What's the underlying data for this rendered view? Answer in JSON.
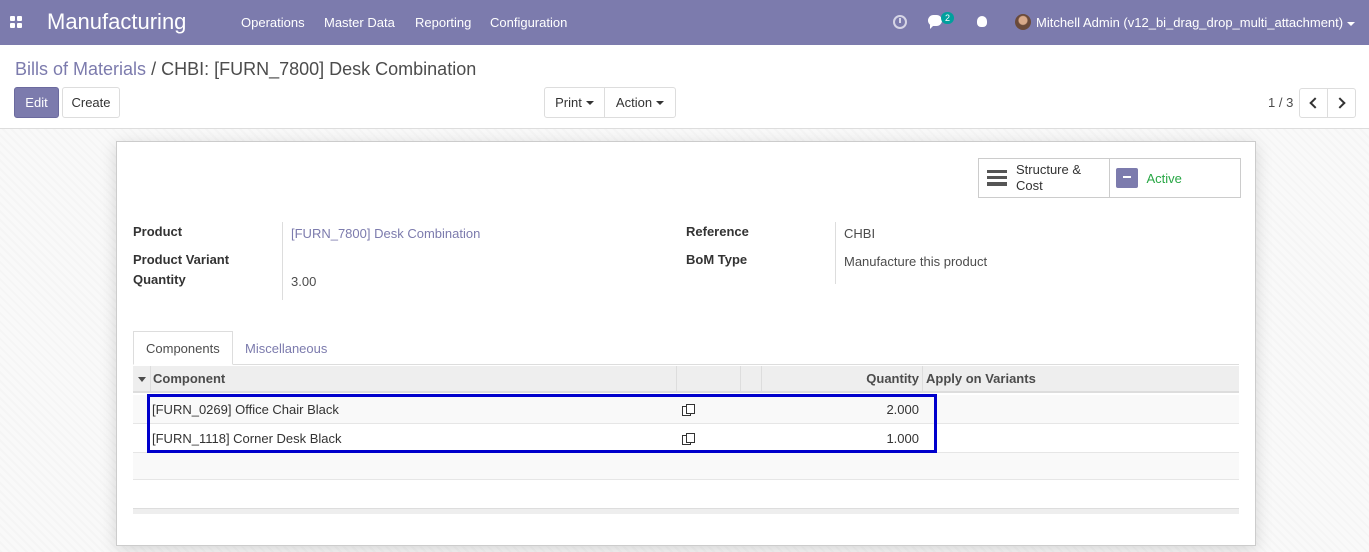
{
  "navbar": {
    "brand": "Manufacturing",
    "menus": [
      "Operations",
      "Master Data",
      "Reporting",
      "Configuration"
    ],
    "chat_count": "2",
    "user": "Mitchell Admin (v12_bi_drag_drop_multi_attachment)"
  },
  "breadcrumb": {
    "parent": "Bills of Materials",
    "separator": "/",
    "current": "CHBI: [FURN_7800] Desk Combination"
  },
  "buttons": {
    "edit": "Edit",
    "create": "Create",
    "print": "Print",
    "action": "Action"
  },
  "pager": {
    "value": "1 / 3"
  },
  "smart_buttons": {
    "structure": "Structure & Cost",
    "active": "Active"
  },
  "fields": {
    "product_label": "Product",
    "product_value": "[FURN_7800] Desk Combination",
    "variant_label": "Product Variant",
    "quantity_label": "Quantity",
    "quantity_value": "3.00",
    "reference_label": "Reference",
    "reference_value": "CHBI",
    "bom_type_label": "BoM Type",
    "bom_type_value": "Manufacture this product"
  },
  "tabs": [
    "Components",
    "Miscellaneous"
  ],
  "table": {
    "headers": {
      "component": "Component",
      "quantity": "Quantity",
      "apply": "Apply on Variants"
    },
    "rows": [
      {
        "component": "[FURN_0269] Office Chair Black",
        "quantity": "2.000"
      },
      {
        "component": "[FURN_1118] Corner Desk Black",
        "quantity": "1.000"
      }
    ]
  },
  "colors": {
    "brand": "#7c7bad",
    "active": "#28a745",
    "highlight": "#0000cc"
  }
}
